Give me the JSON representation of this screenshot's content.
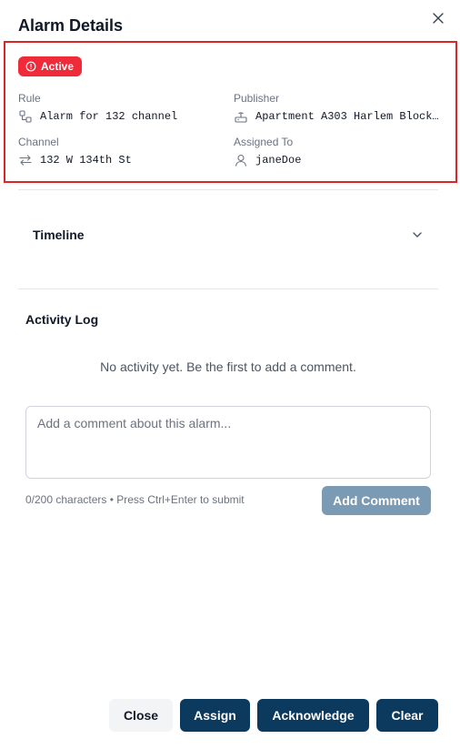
{
  "dialog": {
    "title": "Alarm Details",
    "close_icon": "close-icon"
  },
  "details": {
    "status_badge": "Active",
    "status_color": "#ef2b3a",
    "rule": {
      "label": "Rule",
      "value": "Alarm for 132 channel",
      "icon": "rule-icon"
    },
    "publisher": {
      "label": "Publisher",
      "value": "Apartment A303 Harlem Block…",
      "icon": "publisher-icon"
    },
    "channel": {
      "label": "Channel",
      "value": "132 W 134th St",
      "icon": "swap-arrows-icon"
    },
    "assigned_to": {
      "label": "Assigned To",
      "value": "janeDoe",
      "icon": "user-icon"
    }
  },
  "timeline": {
    "title": "Timeline",
    "icon": "chevron-down-icon"
  },
  "activity_log": {
    "title": "Activity Log",
    "empty_message": "No activity yet. Be the first to add a comment.",
    "comment_placeholder": "Add a comment about this alarm...",
    "comment_value": "",
    "char_hint": "0/200 characters • Press Ctrl+Enter to submit",
    "add_button": "Add Comment"
  },
  "footer": {
    "close": "Close",
    "assign": "Assign",
    "acknowledge": "Acknowledge",
    "clear": "Clear"
  },
  "colors": {
    "primary": "#0b3a5e",
    "highlight_border": "#dc2626",
    "disabled_button": "#7b9ab3"
  }
}
